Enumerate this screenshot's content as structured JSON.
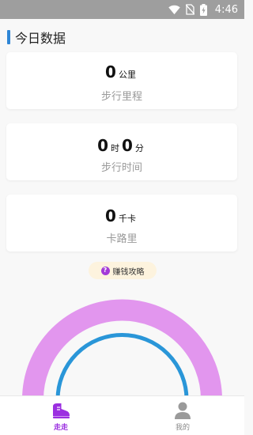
{
  "status_bar": {
    "time": "4:46"
  },
  "section": {
    "title": "今日数据"
  },
  "cards": [
    {
      "value": "0",
      "unit": "公里",
      "label": "步行里程"
    },
    {
      "hours": "0",
      "hours_unit": "时",
      "minutes": "0",
      "minutes_unit": "分",
      "label": "步行时间"
    },
    {
      "value": "0",
      "unit": "千卡",
      "label": "卡路里"
    }
  ],
  "tip": {
    "label": "赚钱攻略"
  },
  "tabs": [
    {
      "label": "走走",
      "active": true
    },
    {
      "label": "我的",
      "active": false
    }
  ],
  "colors": {
    "accent": "#2f86d6",
    "tab_active": "#9b2fe0",
    "tab_inactive": "#888888",
    "gauge_outer": "#e296ee",
    "gauge_inner": "#2a96d8",
    "tip_background": "#fdf3de",
    "tip_icon": "#a33ad8"
  }
}
